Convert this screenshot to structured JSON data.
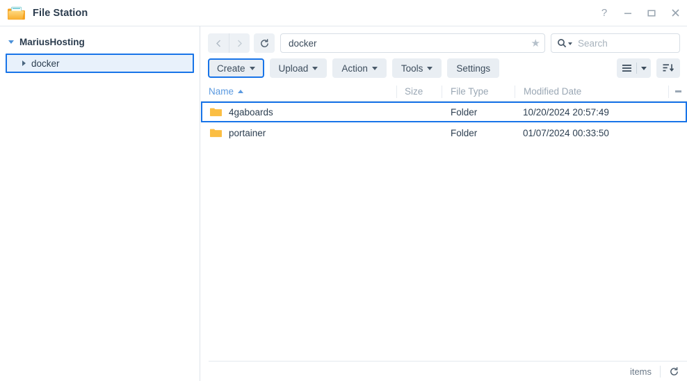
{
  "window": {
    "title": "File Station",
    "app_icon": "folder-open-icon",
    "controls": {
      "help_label": "?",
      "help_icon": "question-mark-icon",
      "minimize_icon": "minimize-icon",
      "maximize_icon": "maximize-icon",
      "close_icon": "close-icon"
    }
  },
  "sidebar": {
    "root": {
      "label": "MariusHosting",
      "expanded": true,
      "icon": "caret-down-icon"
    },
    "items": [
      {
        "label": "docker",
        "expanded": false,
        "selected": true,
        "icon": "caret-right-icon"
      }
    ]
  },
  "toolbar": {
    "back_icon": "chevron-left-icon",
    "forward_icon": "chevron-right-icon",
    "refresh_icon": "refresh-icon",
    "path_value": "docker",
    "path_placeholder": "",
    "favorite_icon": "star-icon",
    "search_icon": "search-icon",
    "search_value": "",
    "search_placeholder": "Search"
  },
  "actions": {
    "buttons": [
      {
        "label": "Create",
        "has_dropdown": true,
        "selected": true
      },
      {
        "label": "Upload",
        "has_dropdown": true,
        "selected": false
      },
      {
        "label": "Action",
        "has_dropdown": true,
        "selected": false
      },
      {
        "label": "Tools",
        "has_dropdown": true,
        "selected": false
      },
      {
        "label": "Settings",
        "has_dropdown": false,
        "selected": false
      }
    ],
    "view_icon": "list-view-icon",
    "view_caret_icon": "caret-down-icon",
    "sort_icon": "sort-descending-icon"
  },
  "table": {
    "columns": [
      {
        "key": "name",
        "label": "Name",
        "sorted": "asc",
        "sort_icon": "caret-up-icon"
      },
      {
        "key": "size",
        "label": "Size"
      },
      {
        "key": "file_type",
        "label": "File Type"
      },
      {
        "key": "modified_date",
        "label": "Modified Date"
      }
    ],
    "options_icon": "kebab-menu-icon",
    "rows": [
      {
        "icon": "folder-icon",
        "name": "4gaboards",
        "size": "",
        "file_type": "Folder",
        "modified_date": "10/20/2024 20:57:49",
        "selected": true
      },
      {
        "icon": "folder-icon",
        "name": "portainer",
        "size": "",
        "file_type": "Folder",
        "modified_date": "01/07/2024 00:33:50",
        "selected": false
      }
    ]
  },
  "status": {
    "items_label": "items",
    "refresh_icon": "refresh-icon"
  },
  "colors": {
    "accent": "#1874e8",
    "folder": "#fbbe43",
    "header_link": "#5b9ae0",
    "text": "#2c3e50",
    "muted": "#9aa7b4"
  }
}
